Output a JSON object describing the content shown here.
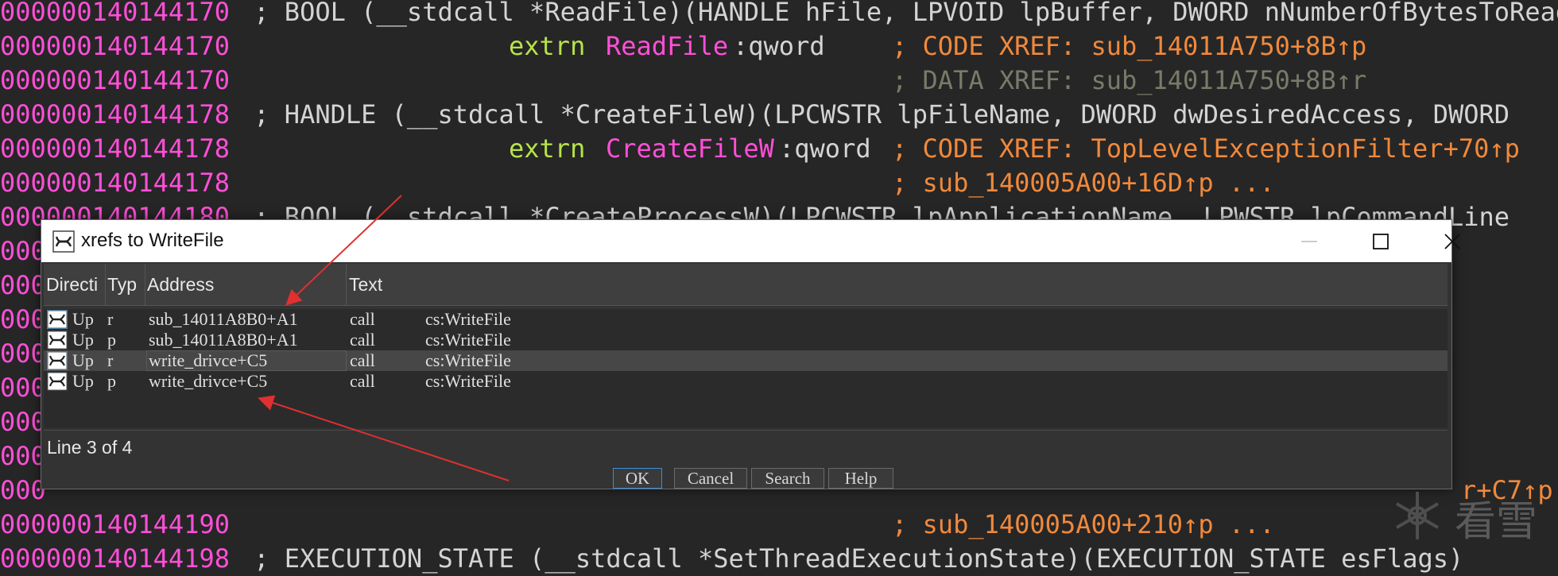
{
  "code_lines": [
    {
      "addr": "000000140144170",
      "text": " ; BOOL (__stdcall *ReadFile)(HANDLE hFile, LPVOID lpBuffer, DWORD nNumberOfBytesToRead"
    },
    {
      "addr": "000000140144170",
      "kw": "extrn",
      "sym": "ReadFile",
      "type": ":qword",
      "comment": "; CODE XREF: sub_14011A750+8B↑p"
    },
    {
      "addr": "000000140144170",
      "comment_dim": "; DATA XREF: sub_14011A750+8B↑r"
    },
    {
      "addr": "000000140144178",
      "text": " ; HANDLE (__stdcall *CreateFileW)(LPCWSTR lpFileName, DWORD dwDesiredAccess, DWORD"
    },
    {
      "addr": "000000140144178",
      "kw": "extrn",
      "sym": "CreateFileW",
      "type": ":qword",
      "comment": "; CODE XREF: TopLevelExceptionFilter+70↑p"
    },
    {
      "addr": "000000140144178",
      "comment": "; sub_140005A00+16D↑p ..."
    },
    {
      "addr": "000000140144180",
      "text": " ; BOOL (__stdcall *CreateProcessW)(LPCWSTR lpApplicationName, LPWSTR lpCommandLine"
    },
    {
      "addr": "000"
    },
    {
      "addr": "000"
    },
    {
      "addr": "000"
    },
    {
      "addr": "000"
    },
    {
      "addr": "000"
    },
    {
      "addr": "000"
    },
    {
      "addr": "000"
    },
    {
      "addr": "000",
      "comment": "r+C7↑p"
    },
    {
      "addr": "000000140144190",
      "comment": "; sub_140005A00+210↑p ..."
    },
    {
      "addr": "000000140144198",
      "text": " ; EXECUTION_STATE (__stdcall *SetThreadExecutionState)(EXECUTION_STATE esFlags)"
    }
  ],
  "dialog": {
    "title": "xrefs to WriteFile",
    "columns": [
      "Directi",
      "Typ",
      "Address",
      "Text"
    ],
    "rows": [
      {
        "direction": "Up",
        "type": "r",
        "address": "sub_14011A8B0+A1",
        "mnemonic": "call",
        "operand": "cs:WriteFile"
      },
      {
        "direction": "Up",
        "type": "p",
        "address": "sub_14011A8B0+A1",
        "mnemonic": "call",
        "operand": "cs:WriteFile"
      },
      {
        "direction": "Up",
        "type": "r",
        "address": "write_drivce+C5",
        "mnemonic": "call",
        "operand": "cs:WriteFile"
      },
      {
        "direction": "Up",
        "type": "p",
        "address": "write_drivce+C5",
        "mnemonic": "call",
        "operand": "cs:WriteFile"
      }
    ],
    "status": "Line 3 of 4",
    "buttons": {
      "ok": "OK",
      "cancel": "Cancel",
      "search": "Search",
      "help": "Help"
    }
  },
  "watermark": "看雪",
  "colors": {
    "address": "#ff4fd8",
    "keyword": "#b7e34a",
    "comment": "#f0893c",
    "background": "#262626",
    "annotation_arrow": "#e03030"
  }
}
